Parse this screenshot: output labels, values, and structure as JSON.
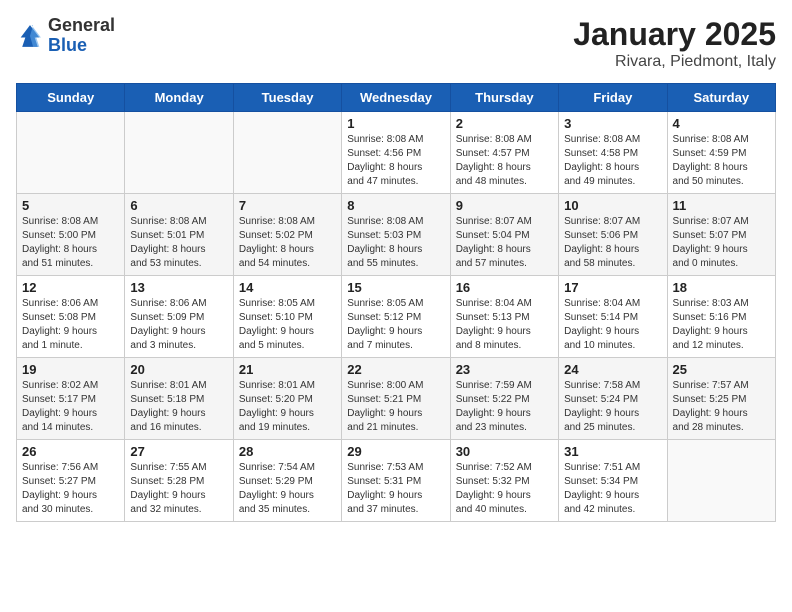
{
  "header": {
    "logo_general": "General",
    "logo_blue": "Blue",
    "month_title": "January 2025",
    "location": "Rivara, Piedmont, Italy"
  },
  "weekdays": [
    "Sunday",
    "Monday",
    "Tuesday",
    "Wednesday",
    "Thursday",
    "Friday",
    "Saturday"
  ],
  "weeks": [
    [
      {
        "day": "",
        "info": ""
      },
      {
        "day": "",
        "info": ""
      },
      {
        "day": "",
        "info": ""
      },
      {
        "day": "1",
        "info": "Sunrise: 8:08 AM\nSunset: 4:56 PM\nDaylight: 8 hours\nand 47 minutes."
      },
      {
        "day": "2",
        "info": "Sunrise: 8:08 AM\nSunset: 4:57 PM\nDaylight: 8 hours\nand 48 minutes."
      },
      {
        "day": "3",
        "info": "Sunrise: 8:08 AM\nSunset: 4:58 PM\nDaylight: 8 hours\nand 49 minutes."
      },
      {
        "day": "4",
        "info": "Sunrise: 8:08 AM\nSunset: 4:59 PM\nDaylight: 8 hours\nand 50 minutes."
      }
    ],
    [
      {
        "day": "5",
        "info": "Sunrise: 8:08 AM\nSunset: 5:00 PM\nDaylight: 8 hours\nand 51 minutes."
      },
      {
        "day": "6",
        "info": "Sunrise: 8:08 AM\nSunset: 5:01 PM\nDaylight: 8 hours\nand 53 minutes."
      },
      {
        "day": "7",
        "info": "Sunrise: 8:08 AM\nSunset: 5:02 PM\nDaylight: 8 hours\nand 54 minutes."
      },
      {
        "day": "8",
        "info": "Sunrise: 8:08 AM\nSunset: 5:03 PM\nDaylight: 8 hours\nand 55 minutes."
      },
      {
        "day": "9",
        "info": "Sunrise: 8:07 AM\nSunset: 5:04 PM\nDaylight: 8 hours\nand 57 minutes."
      },
      {
        "day": "10",
        "info": "Sunrise: 8:07 AM\nSunset: 5:06 PM\nDaylight: 8 hours\nand 58 minutes."
      },
      {
        "day": "11",
        "info": "Sunrise: 8:07 AM\nSunset: 5:07 PM\nDaylight: 9 hours\nand 0 minutes."
      }
    ],
    [
      {
        "day": "12",
        "info": "Sunrise: 8:06 AM\nSunset: 5:08 PM\nDaylight: 9 hours\nand 1 minute."
      },
      {
        "day": "13",
        "info": "Sunrise: 8:06 AM\nSunset: 5:09 PM\nDaylight: 9 hours\nand 3 minutes."
      },
      {
        "day": "14",
        "info": "Sunrise: 8:05 AM\nSunset: 5:10 PM\nDaylight: 9 hours\nand 5 minutes."
      },
      {
        "day": "15",
        "info": "Sunrise: 8:05 AM\nSunset: 5:12 PM\nDaylight: 9 hours\nand 7 minutes."
      },
      {
        "day": "16",
        "info": "Sunrise: 8:04 AM\nSunset: 5:13 PM\nDaylight: 9 hours\nand 8 minutes."
      },
      {
        "day": "17",
        "info": "Sunrise: 8:04 AM\nSunset: 5:14 PM\nDaylight: 9 hours\nand 10 minutes."
      },
      {
        "day": "18",
        "info": "Sunrise: 8:03 AM\nSunset: 5:16 PM\nDaylight: 9 hours\nand 12 minutes."
      }
    ],
    [
      {
        "day": "19",
        "info": "Sunrise: 8:02 AM\nSunset: 5:17 PM\nDaylight: 9 hours\nand 14 minutes."
      },
      {
        "day": "20",
        "info": "Sunrise: 8:01 AM\nSunset: 5:18 PM\nDaylight: 9 hours\nand 16 minutes."
      },
      {
        "day": "21",
        "info": "Sunrise: 8:01 AM\nSunset: 5:20 PM\nDaylight: 9 hours\nand 19 minutes."
      },
      {
        "day": "22",
        "info": "Sunrise: 8:00 AM\nSunset: 5:21 PM\nDaylight: 9 hours\nand 21 minutes."
      },
      {
        "day": "23",
        "info": "Sunrise: 7:59 AM\nSunset: 5:22 PM\nDaylight: 9 hours\nand 23 minutes."
      },
      {
        "day": "24",
        "info": "Sunrise: 7:58 AM\nSunset: 5:24 PM\nDaylight: 9 hours\nand 25 minutes."
      },
      {
        "day": "25",
        "info": "Sunrise: 7:57 AM\nSunset: 5:25 PM\nDaylight: 9 hours\nand 28 minutes."
      }
    ],
    [
      {
        "day": "26",
        "info": "Sunrise: 7:56 AM\nSunset: 5:27 PM\nDaylight: 9 hours\nand 30 minutes."
      },
      {
        "day": "27",
        "info": "Sunrise: 7:55 AM\nSunset: 5:28 PM\nDaylight: 9 hours\nand 32 minutes."
      },
      {
        "day": "28",
        "info": "Sunrise: 7:54 AM\nSunset: 5:29 PM\nDaylight: 9 hours\nand 35 minutes."
      },
      {
        "day": "29",
        "info": "Sunrise: 7:53 AM\nSunset: 5:31 PM\nDaylight: 9 hours\nand 37 minutes."
      },
      {
        "day": "30",
        "info": "Sunrise: 7:52 AM\nSunset: 5:32 PM\nDaylight: 9 hours\nand 40 minutes."
      },
      {
        "day": "31",
        "info": "Sunrise: 7:51 AM\nSunset: 5:34 PM\nDaylight: 9 hours\nand 42 minutes."
      },
      {
        "day": "",
        "info": ""
      }
    ]
  ]
}
